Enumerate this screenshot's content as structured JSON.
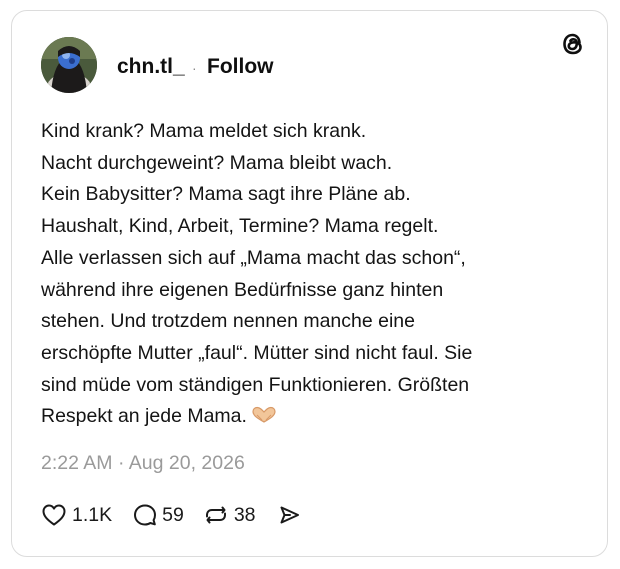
{
  "post": {
    "author": {
      "username": "chn.tl_",
      "separator": "·",
      "follow_label": "Follow",
      "avatar_icon": "profile-avatar"
    },
    "brand_icon": "threads-logo-icon",
    "body_lines": [
      "Kind krank? Mama meldet sich krank.",
      "Nacht durchgeweint? Mama bleibt wach.",
      "Kein Babysitter? Mama sagt ihre Pläne ab.",
      "Haushalt, Kind, Arbeit, Termine? Mama regelt.",
      "Alle verlassen sich auf „Mama macht das schon“,",
      "während ihre eigenen Bedürfnisse ganz hinten",
      "stehen. Und trotzdem nennen manche eine",
      "erschöpfte Mutter „faul“. Mütter sind nicht faul. Sie",
      "sind müde vom ständigen Funktionieren. Größten",
      "Respekt an jede Mama."
    ],
    "emoji": "heart-hands-emoji",
    "timestamp": "2:22 AM · Aug 20, 2026",
    "actions": {
      "likes": "1.1K",
      "comments": "59",
      "reposts": "38"
    },
    "colors": {
      "text": "#141414",
      "muted": "#9a9a9a",
      "border": "#dcdcdc"
    }
  }
}
